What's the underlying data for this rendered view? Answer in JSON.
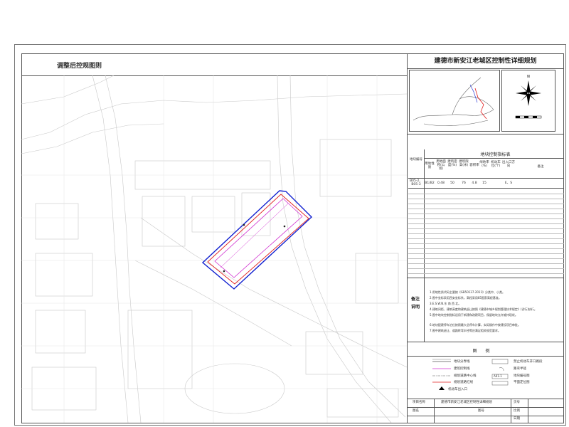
{
  "map_title": "调整后控规图则",
  "plan_title": "建德市新安江老城区控制性详细规划",
  "index_table": {
    "caption": "地块控制指标表",
    "headers": [
      "地块编号",
      "用地性质",
      "用地面积(公顷)",
      "建筑密度(%)",
      "建筑限高(米)",
      "容积率",
      "绿地率(%)",
      "机动车位(个)",
      "出入口方向",
      "备注"
    ],
    "row": [
      "B05-2、B05-3",
      "B1/B2",
      "0.48",
      "50",
      "76",
      "4.8",
      "15",
      "",
      "E、S",
      ""
    ]
  },
  "notes_label": "备注说明",
  "notes": [
    "1.用地性质代码主要按《GB50137-2011》分类中、小类。",
    "2.图中坐标采用西安坐标系，高程采用85国家高程基准。",
    "3.E.S.W.N.东 南 西 北。",
    "4.建筑间距、建筑高度和建筑退让按照《建德市城乡规划管理技术规定》(试行)执行。",
    "5.图中地块控制指标适用于新建和改建项目，保留地块允许维持现状。",
    "6.地块配建停车泊位按照最大总停车计算，实际操作中按建设项目审批。",
    "7.图中建筑退让、道路转弯半径等应满足相关规范要求。"
  ],
  "legend": {
    "title": "图例",
    "items": [
      {
        "label": "地块分界线",
        "symbol": "block-boundary"
      },
      {
        "label": "建筑控制线",
        "symbol": "building-control-line"
      },
      {
        "label": "规划道路中心线",
        "symbol": "road-centerline"
      },
      {
        "label": "规划道路红线",
        "symbol": "road-redline"
      },
      {
        "label": "机动车出入口",
        "symbol": "vehicle-entrance"
      },
      {
        "label": "禁止机动车开口路段",
        "symbol": "no-entry-segment"
      },
      {
        "label": "路弯半径",
        "symbol": "curve-radius"
      },
      {
        "label": "地块编号图",
        "symbol": "block-number",
        "badge": "A01-1"
      },
      {
        "label": "平面定位图",
        "symbol": "location-map"
      }
    ]
  },
  "title_block": {
    "project_label": "项目名称",
    "project_value": "建德市新安江老城区控制性详细规划",
    "drawing_label": "图名",
    "drawing_no_label": "图号",
    "sheet_label": "页号",
    "scale_label": "比例",
    "date_label": "日期"
  },
  "compass": {
    "north_label": "N"
  },
  "colors": {
    "redline": "#e02020",
    "control": "#d030d0",
    "boundary": "#1020d0",
    "basemap": "#c8c8c8"
  }
}
